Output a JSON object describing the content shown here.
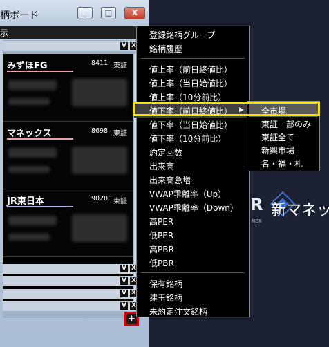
{
  "window": {
    "title": "柄ボード",
    "menu_text": "示",
    "buttons": {
      "minimize": "_",
      "maximize": "□",
      "close": "X"
    }
  },
  "panel_controls": {
    "v": "V",
    "x": "X"
  },
  "stocks": [
    {
      "name": "みずほFG",
      "code": "8411",
      "market": "東証",
      "underline_color": "#e8a0a8"
    },
    {
      "name": "マネックス",
      "code": "8698",
      "market": "東証",
      "underline_color": "#e8a0a8"
    },
    {
      "name": "JR東日本",
      "code": "9020",
      "market": "東証",
      "underline_color": "#aab0e8"
    }
  ],
  "add_button": {
    "label": "+"
  },
  "background_logo": {
    "mark": "R",
    "small_text": "NEX",
    "text": "新マネッ"
  },
  "context_menu": {
    "group1": [
      "登録銘柄グループ",
      "銘柄履歴"
    ],
    "group2": [
      "値上率（前日終値比）",
      "値上率（当日始値比）",
      "値上率（10分前比）",
      "値下率（前日終値比）",
      "値下率（当日始値比）",
      "値下率（10分前比）",
      "約定回数",
      "出来高",
      "出来高急増",
      "VWAP乖離率（Up）",
      "VWAP乖離率（Down）",
      "高PER",
      "低PER",
      "高PBR",
      "低PBR"
    ],
    "group3": [
      "保有銘柄",
      "建玉銘柄",
      "未約定注文銘柄"
    ],
    "submenu_arrow": "▶"
  },
  "submenu": {
    "items": [
      "全市場",
      "東証一部のみ",
      "東証全て",
      "新興市場",
      "名・福・札"
    ]
  },
  "colors": {
    "highlight_box": "#f5e400",
    "add_button_border": "#e00000"
  }
}
